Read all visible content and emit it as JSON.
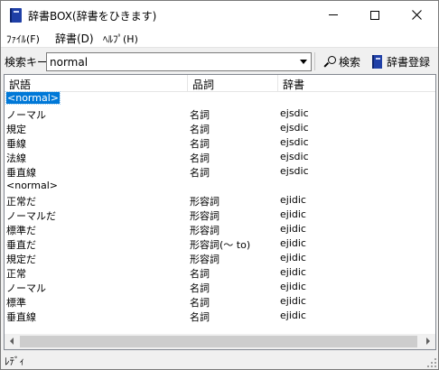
{
  "window": {
    "title": "辞書BOX(辞書をひきます)"
  },
  "menu": {
    "file": "ﾌｧｲﾙ(F)",
    "dictionary": "辞書(D)",
    "help": "ﾍﾙﾌﾟ(H)"
  },
  "toolbar": {
    "search_label": "検索キー",
    "search_value": "normal",
    "search_button": "検索",
    "register_button": "辞書登録"
  },
  "list": {
    "columns": [
      "訳語",
      "品詞",
      "辞書"
    ],
    "rows": [
      {
        "term": "<normal>",
        "pos": "",
        "dict": "",
        "selected": true
      },
      {
        "term": "ノーマル",
        "pos": "名詞",
        "dict": "ejsdic"
      },
      {
        "term": "規定",
        "pos": "名詞",
        "dict": "ejsdic"
      },
      {
        "term": "垂線",
        "pos": "名詞",
        "dict": "ejsdic"
      },
      {
        "term": "法線",
        "pos": "名詞",
        "dict": "ejsdic"
      },
      {
        "term": "垂直線",
        "pos": "名詞",
        "dict": "ejsdic"
      },
      {
        "term": "<normal>",
        "pos": "",
        "dict": ""
      },
      {
        "term": "正常だ",
        "pos": "形容詞",
        "dict": "ejidic"
      },
      {
        "term": "ノーマルだ",
        "pos": "形容詞",
        "dict": "ejidic"
      },
      {
        "term": "標準だ",
        "pos": "形容詞",
        "dict": "ejidic"
      },
      {
        "term": "垂直だ",
        "pos": "形容詞(〜 to)",
        "dict": "ejidic"
      },
      {
        "term": "規定だ",
        "pos": "形容詞",
        "dict": "ejidic"
      },
      {
        "term": "正常",
        "pos": "名詞",
        "dict": "ejidic"
      },
      {
        "term": "ノーマル",
        "pos": "名詞",
        "dict": "ejidic"
      },
      {
        "term": "標準",
        "pos": "名詞",
        "dict": "ejidic"
      },
      {
        "term": "垂直線",
        "pos": "名詞",
        "dict": "ejidic"
      }
    ]
  },
  "status": {
    "text": "ﾚﾃﾞｨ"
  },
  "colors": {
    "selection": "#0078d7",
    "icon_blue": "#1f3fa6"
  }
}
